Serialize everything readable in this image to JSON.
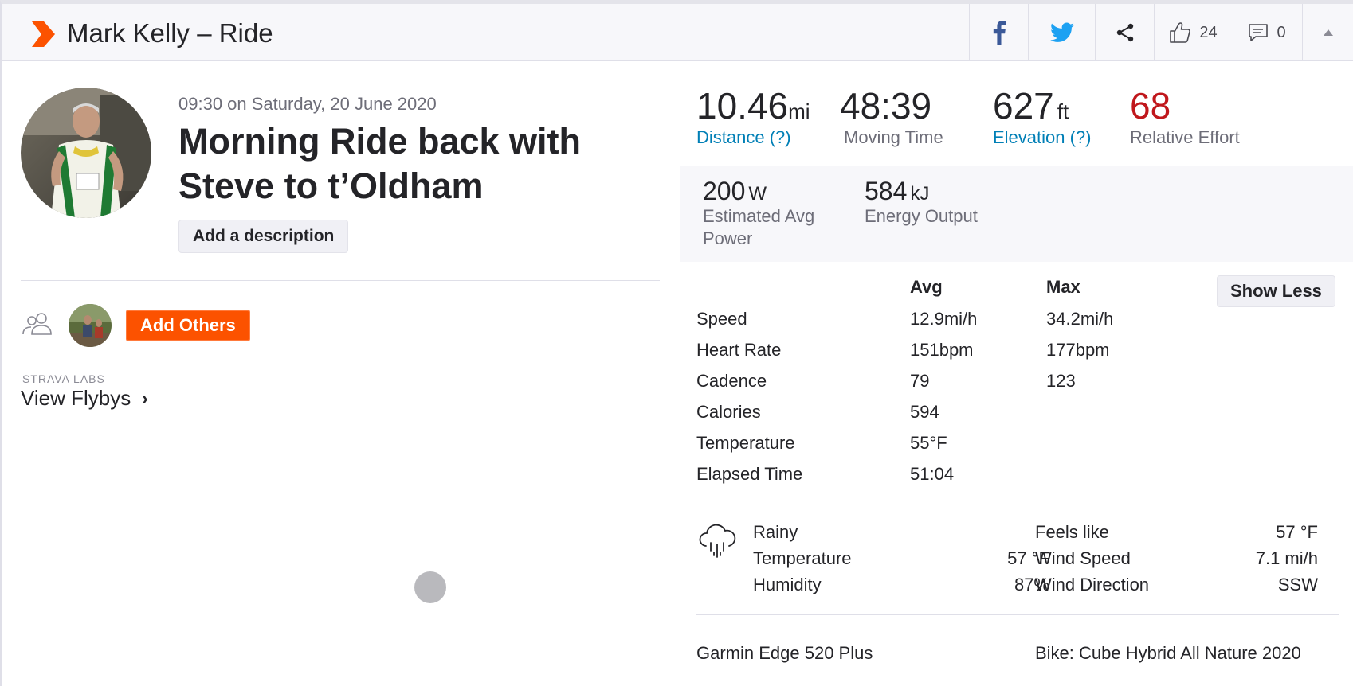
{
  "header": {
    "title": "Mark Kelly – Ride",
    "kudos_count": "24",
    "comment_count": "0",
    "brand_color": "#fc5200"
  },
  "activity": {
    "date": "09:30 on Saturday, 20 June 2020",
    "title": "Morning Ride back with Steve to t’Oldham",
    "add_description_label": "Add a description",
    "add_others_label": "Add Others",
    "labs_label": "STRAVA LABS",
    "flybys_label": "View Flybys",
    "flybys_chevron": "›"
  },
  "stats": {
    "distance": {
      "value": "10.46",
      "unit": "mi",
      "label": "Distance (?)"
    },
    "moving_time": {
      "value": "48:39",
      "label": "Moving Time"
    },
    "elevation": {
      "value": "627",
      "unit": "ft",
      "label": "Elevation (?)"
    },
    "relative_effort": {
      "value": "68",
      "label": "Relative Effort",
      "color": "#c0171c"
    },
    "power": {
      "value": "200",
      "unit": "W",
      "label_line1": "Estimated Avg",
      "label_line2": "Power"
    },
    "energy": {
      "value": "584",
      "unit": "kJ",
      "label": "Energy Output"
    }
  },
  "table": {
    "avg_header": "Avg",
    "max_header": "Max",
    "show_less_label": "Show Less",
    "rows": [
      {
        "label": "Speed",
        "avg": "12.9mi/h",
        "max": "34.2mi/h"
      },
      {
        "label": "Heart Rate",
        "avg": "151bpm",
        "max": "177bpm"
      },
      {
        "label": "Cadence",
        "avg": "79",
        "max": "123"
      },
      {
        "label": "Calories",
        "avg": "594",
        "max": ""
      },
      {
        "label": "Temperature",
        "avg": "55°F",
        "max": ""
      },
      {
        "label": "Elapsed Time",
        "avg": "51:04",
        "max": ""
      }
    ]
  },
  "weather": {
    "condition": "Rainy",
    "temperature_label": "Temperature",
    "temperature_value": "57 °F",
    "humidity_label": "Humidity",
    "humidity_value": "87%",
    "feels_like_label": "Feels like",
    "feels_like_value": "57 °F",
    "wind_speed_label": "Wind Speed",
    "wind_speed_value": "7.1 mi/h",
    "wind_direction_label": "Wind Direction",
    "wind_direction_value": "SSW"
  },
  "gear": {
    "device": "Garmin Edge 520 Plus",
    "bike": "Bike: Cube Hybrid All Nature 2020"
  }
}
